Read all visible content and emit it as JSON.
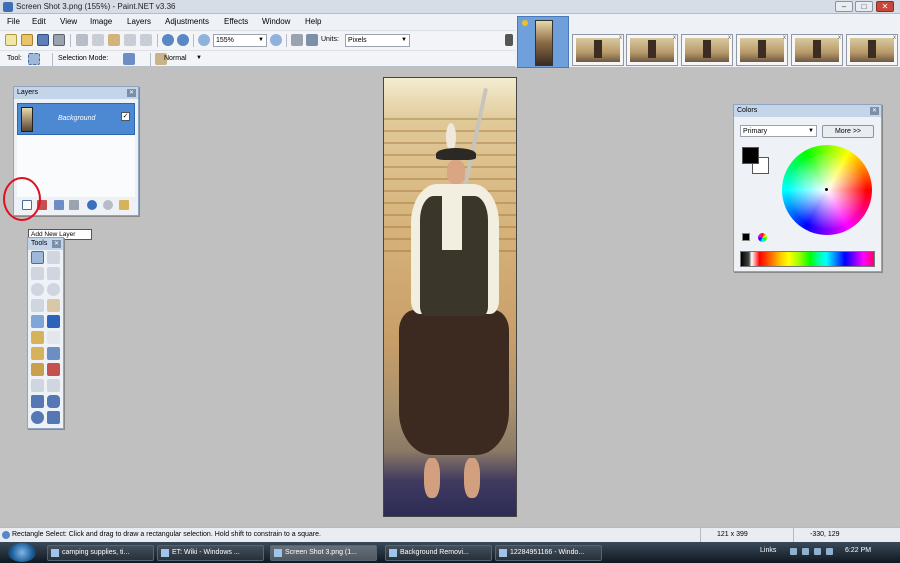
{
  "window": {
    "title": "Screen Shot 3.png (155%) - Paint.NET v3.36",
    "min": "–",
    "max": "□",
    "close": "✕"
  },
  "menu": [
    "File",
    "Edit",
    "View",
    "Image",
    "Layers",
    "Adjustments",
    "Effects",
    "Window",
    "Help"
  ],
  "toolbar": {
    "zoom": "155%",
    "units_label": "Units:",
    "units_value": "Pixels"
  },
  "toolbar2": {
    "tool_label": "Tool:",
    "selection_mode_label": "Selection Mode:",
    "blend_mode": "Normal"
  },
  "layers": {
    "title": "Layers",
    "items": [
      {
        "name": "Background",
        "visible": true
      }
    ],
    "tooltip": "Add New Layer"
  },
  "tools": {
    "title": "Tools"
  },
  "colors": {
    "title": "Colors",
    "selector": "Primary",
    "more_button": "More >>",
    "primary_color": "#000000",
    "secondary_color": "#ffffff"
  },
  "status": {
    "message": "Rectangle Select: Click and drag to draw a rectangular selection. Hold shift to constrain to a square.",
    "size": "121 x 399",
    "cursor": "-330, 129"
  },
  "taskbar": {
    "items": [
      "camping supplies, ti...",
      "ET: Wiki - Windows ...",
      "Screen Shot 3.png (1...",
      "Background Removi...",
      "12284951166 - Windo..."
    ],
    "links_label": "Links",
    "clock": "6:22 PM"
  },
  "icons": [
    "new-image-icon",
    "open-icon",
    "save-icon",
    "print-icon",
    "cut-icon",
    "copy-icon",
    "paste-icon",
    "undo-icon",
    "redo-icon",
    "zoom-out-icon",
    "zoom-in-icon",
    "grid-icon",
    "add-new-layer-icon",
    "delete-layer-icon",
    "duplicate-layer-icon",
    "merge-layer-icon",
    "move-layer-up-icon",
    "move-layer-down-icon",
    "layer-properties-icon"
  ]
}
